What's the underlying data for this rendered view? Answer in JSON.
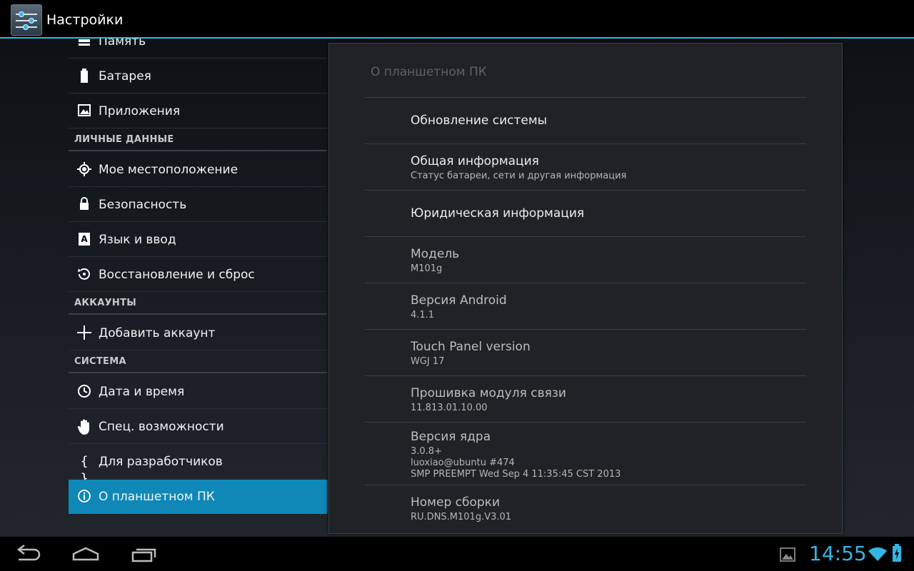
{
  "app": {
    "title": "Настройки"
  },
  "left": {
    "items_top": [
      {
        "label": "Память",
        "icon": "storage-icon"
      },
      {
        "label": "Батарея",
        "icon": "battery-icon"
      },
      {
        "label": "Приложения",
        "icon": "apps-icon"
      }
    ],
    "header_personal": "ЛИЧНЫЕ ДАННЫЕ",
    "items_personal": [
      {
        "label": "Мое местоположение",
        "icon": "location-icon"
      },
      {
        "label": "Безопасность",
        "icon": "lock-icon"
      },
      {
        "label": "Язык и ввод",
        "icon": "language-icon"
      },
      {
        "label": "Восстановление и сброс",
        "icon": "reset-icon"
      }
    ],
    "header_accounts": "АККАУНТЫ",
    "items_accounts": [
      {
        "label": "Добавить аккаунт",
        "icon": "plus-icon"
      }
    ],
    "header_system": "СИСТЕМА",
    "items_system": [
      {
        "label": "Дата и время",
        "icon": "clock-icon"
      },
      {
        "label": "Спец. возможности",
        "icon": "hand-icon"
      },
      {
        "label": "Для разработчиков",
        "icon": "braces-icon"
      },
      {
        "label": "О планшетном ПК",
        "icon": "info-icon"
      }
    ]
  },
  "right": {
    "title": "О планшетном ПК",
    "items": [
      {
        "title": "Обновление системы",
        "sub": ""
      },
      {
        "title": "Общая информация",
        "sub": "Статус батареи, сети и другая информация"
      },
      {
        "title": "Юридическая информация",
        "sub": ""
      },
      {
        "title": "Модель",
        "sub": "M101g"
      },
      {
        "title": "Версия Android",
        "sub": "4.1.1"
      },
      {
        "title": "Touch Panel version",
        "sub": "WGJ 17"
      },
      {
        "title": "Прошивка модуля связи",
        "sub": "11.813.01.10.00"
      },
      {
        "title": "Версия ядра",
        "sub1": "3.0.8+",
        "sub2": "luoxiao@ubuntu #474",
        "sub3": "SMP PREEMPT Wed Sep 4 11:35:45 CST 2013"
      },
      {
        "title": "Номер сборки",
        "sub": "RU.DNS.M101g.V3.01"
      }
    ]
  },
  "status": {
    "time": "14:55"
  },
  "colors": {
    "accent": "#33b5e5",
    "selected": "#0f88b8"
  }
}
